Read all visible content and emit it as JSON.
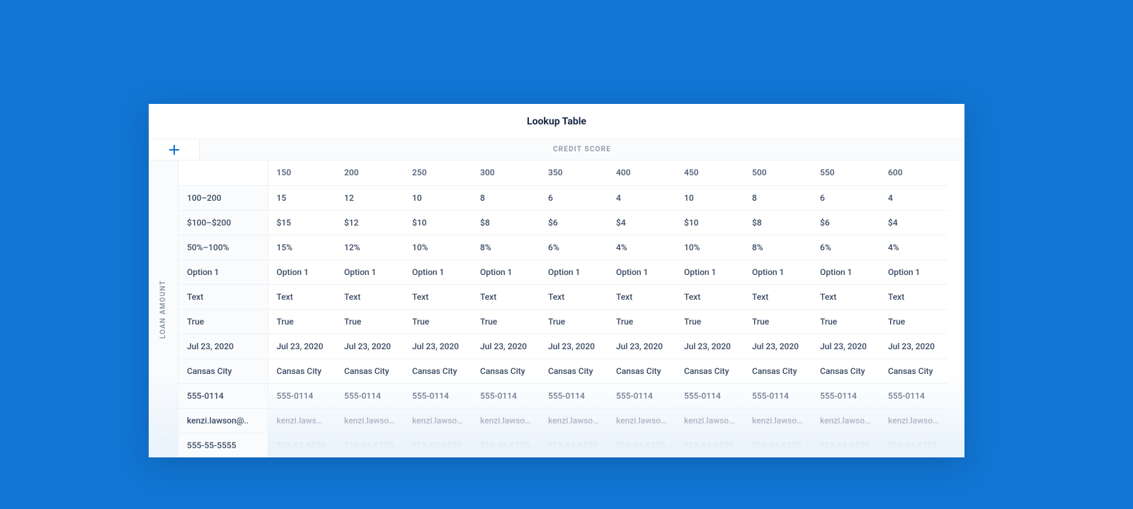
{
  "title": "Lookup Table",
  "axes": {
    "columns_label": "CREDIT SCORE",
    "rows_label": "LOAN AMOUNT"
  },
  "column_headers": [
    "150",
    "200",
    "250",
    "300",
    "350",
    "400",
    "450",
    "500",
    "550",
    "600"
  ],
  "rows": [
    {
      "label": "100–200",
      "cells": [
        "15",
        "12",
        "10",
        "8",
        "6",
        "4",
        "10",
        "8",
        "6",
        "4"
      ]
    },
    {
      "label": "$100–$200",
      "cells": [
        "$15",
        "$12",
        "$10",
        "$8",
        "$6",
        "$4",
        "$10",
        "$8",
        "$6",
        "$4"
      ]
    },
    {
      "label": "50%–100%",
      "cells": [
        "15%",
        "12%",
        "10%",
        "8%",
        "6%",
        "4%",
        "10%",
        "8%",
        "6%",
        "4%"
      ]
    },
    {
      "label": "Option 1",
      "cells": [
        "Option 1",
        "Option 1",
        "Option 1",
        "Option 1",
        "Option 1",
        "Option 1",
        "Option 1",
        "Option 1",
        "Option 1",
        "Option 1"
      ]
    },
    {
      "label": "Text",
      "cells": [
        "Text",
        "Text",
        "Text",
        "Text",
        "Text",
        "Text",
        "Text",
        "Text",
        "Text",
        "Text"
      ]
    },
    {
      "label": "True",
      "cells": [
        "True",
        "True",
        "True",
        "True",
        "True",
        "True",
        "True",
        "True",
        "True",
        "True"
      ]
    },
    {
      "label": "Jul 23, 2020",
      "cells": [
        "Jul 23, 2020",
        "Jul 23, 2020",
        "Jul 23, 2020",
        "Jul 23, 2020",
        "Jul 23, 2020",
        "Jul 23, 2020",
        "Jul 23, 2020",
        "Jul 23, 2020",
        "Jul 23, 2020",
        "Jul 23, 2020"
      ]
    },
    {
      "label": "Cansas City",
      "cells": [
        "Cansas City",
        "Cansas City",
        "Cansas City",
        "Cansas City",
        "Cansas City",
        "Cansas City",
        "Cansas City",
        "Cansas City",
        "Cansas City",
        "Cansas City"
      ]
    },
    {
      "label": "555-0114",
      "cells": [
        "555-0114",
        "555-0114",
        "555-0114",
        "555-0114",
        "555-0114",
        "555-0114",
        "555-0114",
        "555-0114",
        "555-0114",
        "555-0114"
      ]
    },
    {
      "label": "kenzi.lawson@..",
      "cells": [
        "kenzi.lawson@..",
        "kenzi.lawson@..",
        "kenzi.lawson@..",
        "kenzi.lawson@..",
        "kenzi.lawson@..",
        "kenzi.lawson@..",
        "kenzi.lawson@..",
        "kenzi.lawson@..",
        "kenzi.lawson@..",
        "kenzi.lawson@.."
      ]
    },
    {
      "label": "555-55-5555",
      "cells": [
        "555-55-5555",
        "555-55-5555",
        "555-55-5555",
        "555-55-5555",
        "555-55-5555",
        "555-55-5555",
        "555-55-5555",
        "555-55-5555",
        "555-55-5555",
        "555-55-5555"
      ]
    }
  ]
}
